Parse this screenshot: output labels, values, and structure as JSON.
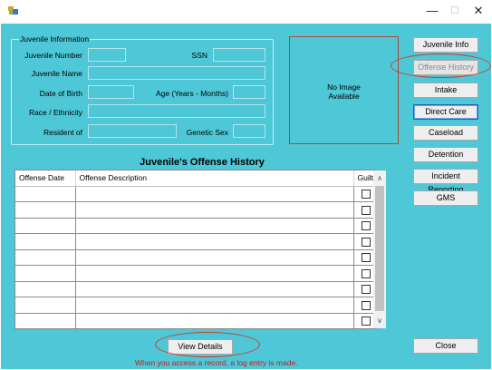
{
  "window": {
    "minimize": "—",
    "maximize": "☐",
    "close": "✕"
  },
  "info": {
    "legend": "Juvenile Information",
    "number_label": "Juvenile Number",
    "ssn_label": "SSN",
    "name_label": "Juvenile Name",
    "dob_label": "Date of Birth",
    "age_label": "Age (Years - Months)",
    "race_label": "Race / Ethnicity",
    "resident_label": "Resident of",
    "sex_label": "Genetic Sex"
  },
  "photo": {
    "line1": "No Image",
    "line2": "Available"
  },
  "sidebar": [
    {
      "label": "Juvenile Info"
    },
    {
      "label": "Offense History"
    },
    {
      "label": "Intake"
    },
    {
      "label": "Direct Care"
    },
    {
      "label": "Caseload"
    },
    {
      "label": "Detention"
    },
    {
      "label": "Incident Reporting"
    },
    {
      "label": "GMS"
    }
  ],
  "grid": {
    "title": "Juvenile's Offense History",
    "columns": [
      "Offense Date",
      "Offense Description",
      "Guilty"
    ],
    "rows": [
      {
        "date": "",
        "description": "",
        "guilty": false
      },
      {
        "date": "",
        "description": "",
        "guilty": false
      },
      {
        "date": "",
        "description": "",
        "guilty": false
      },
      {
        "date": "",
        "description": "",
        "guilty": false
      },
      {
        "date": "",
        "description": "",
        "guilty": false
      },
      {
        "date": "",
        "description": "",
        "guilty": false
      },
      {
        "date": "",
        "description": "",
        "guilty": false
      },
      {
        "date": "",
        "description": "",
        "guilty": false
      },
      {
        "date": "",
        "description": "",
        "guilty": false
      }
    ],
    "scroll_up": "∧",
    "scroll_down": "∨"
  },
  "actions": {
    "view_details": "View Details",
    "close": "Close",
    "log_note": "When you access a record, a log entry is made."
  },
  "colors": {
    "form_background": "#4ec7d6",
    "highlight_ellipse": "#d23b2f",
    "note_text": "#c41f1f"
  }
}
